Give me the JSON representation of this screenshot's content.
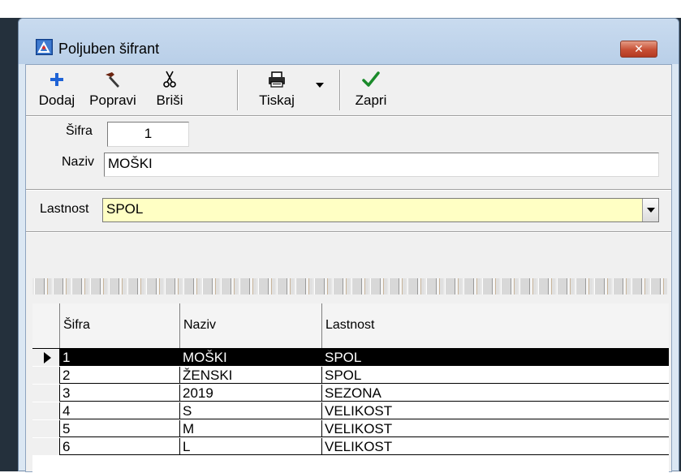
{
  "window": {
    "title": "Poljuben šifrant",
    "close_label": "✕"
  },
  "toolbar": {
    "add_label": "Dodaj",
    "edit_label": "Popravi",
    "delete_label": "Briši",
    "print_label": "Tiskaj",
    "close_label": "Zapri"
  },
  "form": {
    "code_label": "Šifra",
    "code_value": "1",
    "name_label": "Naziv",
    "name_value": "MOŠKI",
    "property_label": "Lastnost",
    "property_value": "SPOL"
  },
  "grid": {
    "columns": [
      "Šifra",
      "Naziv",
      "Lastnost"
    ],
    "rows": [
      [
        "1",
        "MOŠKI",
        "SPOL"
      ],
      [
        "2",
        "ŽENSKI",
        "SPOL"
      ],
      [
        "3",
        "2019",
        "SEZONA"
      ],
      [
        "4",
        "S",
        "VELIKOST"
      ],
      [
        "5",
        "M",
        "VELIKOST"
      ],
      [
        "6",
        "L",
        "VELIKOST"
      ]
    ],
    "selected_row": 0
  },
  "colors": {
    "combo_background": "#ffffc4",
    "selection_background": "#000000",
    "add_icon": "#1f63d6",
    "close_icon": "#1a8a2a",
    "close_button": "#c74f34"
  },
  "icons": {
    "add": "plus-icon",
    "edit": "hammer-icon",
    "delete": "scissors-icon",
    "print": "printer-icon",
    "close": "checkmark-icon"
  }
}
